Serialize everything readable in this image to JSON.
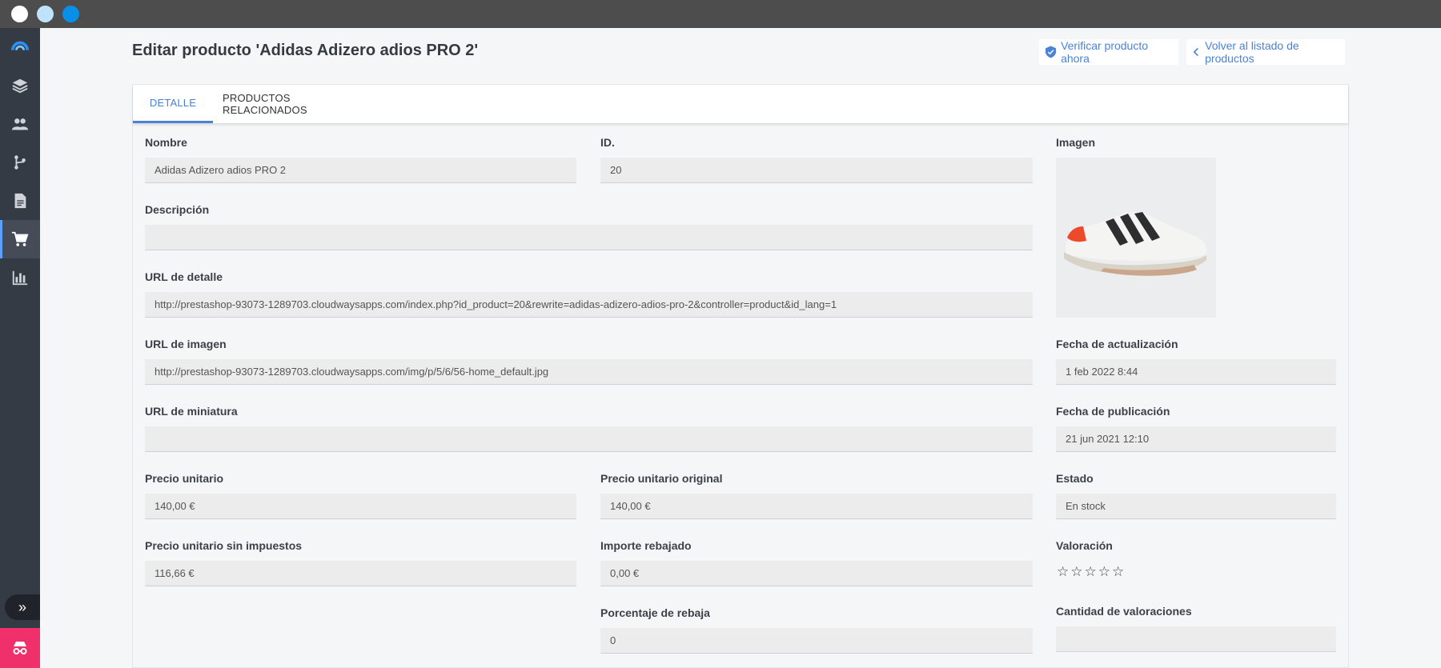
{
  "window": {
    "controls": [
      "close",
      "minimize",
      "maximize"
    ]
  },
  "sidebar": {
    "items": [
      {
        "name": "dashboard",
        "icon": "rainbow-icon"
      },
      {
        "name": "layers",
        "icon": "layers-icon"
      },
      {
        "name": "users",
        "icon": "users-icon"
      },
      {
        "name": "flows",
        "icon": "branch-icon"
      },
      {
        "name": "documents",
        "icon": "document-icon"
      },
      {
        "name": "products",
        "icon": "cart-icon",
        "active": true
      },
      {
        "name": "analytics",
        "icon": "bar-chart-icon"
      }
    ],
    "expand_label": "»"
  },
  "header": {
    "title": "Editar producto 'Adidas Adizero adios PRO 2'",
    "verify_label": "Verificar producto ahora",
    "back_label": "Volver al listado de productos"
  },
  "tabs": [
    {
      "label": "DETALLE",
      "active": true
    },
    {
      "label": "PRODUCTOS RELACIONADOS",
      "active": false
    }
  ],
  "form": {
    "nombre": {
      "label": "Nombre",
      "value": "Adidas Adizero adios PRO 2"
    },
    "id": {
      "label": "ID.",
      "value": "20"
    },
    "imagen": {
      "label": "Imagen"
    },
    "descripcion": {
      "label": "Descripción",
      "value": ""
    },
    "url_detalle": {
      "label": "URL de detalle",
      "value": "http://prestashop-93073-1289703.cloudwaysapps.com/index.php?id_product=20&rewrite=adidas-adizero-adios-pro-2&controller=product&id_lang=1"
    },
    "url_imagen": {
      "label": "URL de imagen",
      "value": "http://prestashop-93073-1289703.cloudwaysapps.com/img/p/5/6/56-home_default.jpg"
    },
    "fecha_actualizacion": {
      "label": "Fecha de actualización",
      "value": "1 feb 2022 8:44"
    },
    "url_miniatura": {
      "label": "URL de miniatura",
      "value": ""
    },
    "fecha_publicacion": {
      "label": "Fecha de publicación",
      "value": "21 jun 2021 12:10"
    },
    "precio_unitario": {
      "label": "Precio unitario",
      "value": "140,00 €"
    },
    "precio_original": {
      "label": "Precio unitario original",
      "value": "140,00 €"
    },
    "estado": {
      "label": "Estado",
      "value": "En stock"
    },
    "precio_sin_impuestos": {
      "label": "Precio unitario sin impuestos",
      "value": "116,66 €"
    },
    "importe_rebajado": {
      "label": "Importe rebajado",
      "value": "0,00 €"
    },
    "valoracion": {
      "label": "Valoración",
      "stars_filled": 0,
      "stars_total": 5
    },
    "porcentaje_rebaja": {
      "label": "Porcentaje de rebaja",
      "value": "0"
    },
    "cantidad_valoraciones": {
      "label": "Cantidad de valoraciones",
      "value": ""
    }
  },
  "colors": {
    "accent": "#4a82d6",
    "sidebar": "#353b45",
    "spy_button": "#f0306a"
  }
}
